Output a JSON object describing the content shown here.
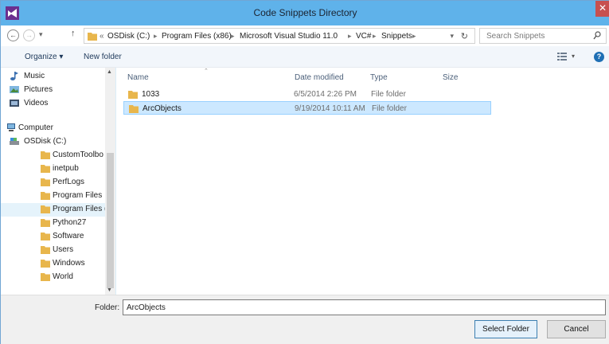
{
  "window": {
    "title": "Code Snippets Directory",
    "close_glyph": "✕"
  },
  "address": {
    "crumbs": [
      "OSDisk (C:)",
      "Program Files (x86)",
      "Microsoft Visual Studio 11.0",
      "VC#",
      "Snippets"
    ],
    "overflow": "«",
    "search_placeholder": "Search Snippets"
  },
  "toolbar": {
    "organize": "Organize ▾",
    "new_folder": "New folder",
    "help": "?"
  },
  "nav": {
    "items": [
      {
        "label": "Music",
        "icon": "music-icon"
      },
      {
        "label": "Pictures",
        "icon": "pictures-icon"
      },
      {
        "label": "Videos",
        "icon": "videos-icon"
      },
      {
        "label": "Computer",
        "icon": "computer-icon"
      },
      {
        "label": "OSDisk (C:)",
        "icon": "drive-icon"
      },
      {
        "label": "CustomToolbo",
        "icon": "folder-icon"
      },
      {
        "label": "inetpub",
        "icon": "folder-icon"
      },
      {
        "label": "PerfLogs",
        "icon": "folder-icon"
      },
      {
        "label": "Program Files",
        "icon": "folder-icon"
      },
      {
        "label": "Program Files (",
        "icon": "folder-icon"
      },
      {
        "label": "Python27",
        "icon": "folder-icon"
      },
      {
        "label": "Software",
        "icon": "folder-icon"
      },
      {
        "label": "Users",
        "icon": "folder-icon"
      },
      {
        "label": "Windows",
        "icon": "folder-icon"
      },
      {
        "label": "World",
        "icon": "folder-icon"
      }
    ]
  },
  "columns": {
    "name": "Name",
    "date": "Date modified",
    "type": "Type",
    "size": "Size"
  },
  "files": [
    {
      "name": "1033",
      "date": "6/5/2014 2:26 PM",
      "type": "File folder"
    },
    {
      "name": "ArcObjects",
      "date": "9/19/2014 10:11 AM",
      "type": "File folder"
    }
  ],
  "footer": {
    "folder_label": "Folder:",
    "folder_value": "ArcObjects",
    "select_button": "Select Folder",
    "cancel_button": "Cancel"
  },
  "colors": {
    "titlebar": "#5fb2ea",
    "selection": "#cce8ff",
    "folder": "#e8b64c"
  }
}
